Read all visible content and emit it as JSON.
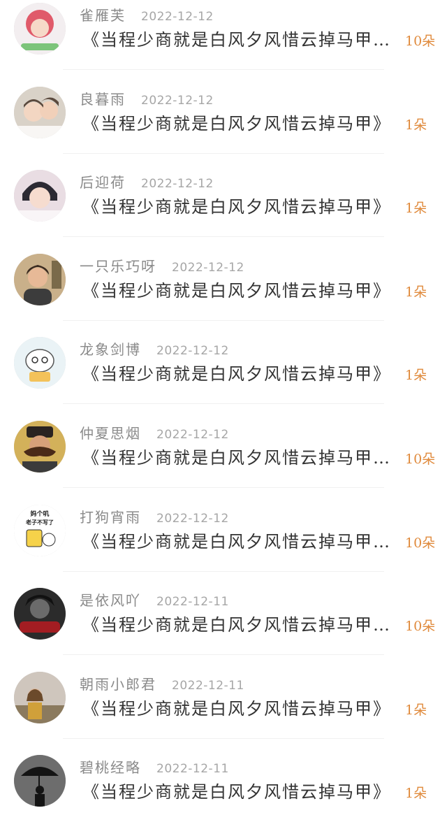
{
  "records": [
    {
      "name": "雀雁芙",
      "date": "2022-12-12",
      "title": "《当程少商就是白风夕风惜云掉马甲…",
      "count": "10朵",
      "avatar": "pink-hair-avatar",
      "avatar_bg": "#f7c6cf",
      "avatar_fg": "#e05a6a"
    },
    {
      "name": "良暮雨",
      "date": "2022-12-12",
      "title": "《当程少商就是白风夕风惜云掉马甲》",
      "count": "1朵",
      "avatar": "kids-avatar",
      "avatar_bg": "#d9d2c8",
      "avatar_fg": "#5b4a3e"
    },
    {
      "name": "后迎荷",
      "date": "2022-12-12",
      "title": "《当程少商就是白风夕风惜云掉马甲》",
      "count": "1朵",
      "avatar": "girl-avatar",
      "avatar_bg": "#e9dde3",
      "avatar_fg": "#2c2a33"
    },
    {
      "name": "一只乐巧呀",
      "date": "2022-12-12",
      "title": "《当程少商就是白风夕风惜云掉马甲》",
      "count": "1朵",
      "avatar": "woman-avatar",
      "avatar_bg": "#c9b08a",
      "avatar_fg": "#3a2a20"
    },
    {
      "name": "龙象剑博",
      "date": "2022-12-12",
      "title": "《当程少商就是白风夕风惜云掉马甲》",
      "count": "1朵",
      "avatar": "cartoon-cat-avatar",
      "avatar_bg": "#eaf3f6",
      "avatar_fg": "#f3c25a"
    },
    {
      "name": "仲夏思烟",
      "date": "2022-12-12",
      "title": "《当程少商就是白风夕风惜云掉马甲…",
      "count": "10朵",
      "avatar": "mustache-man-avatar",
      "avatar_bg": "#d3b15a",
      "avatar_fg": "#2a2320"
    },
    {
      "name": "打狗宵雨",
      "date": "2022-12-12",
      "title": "《当程少商就是白风夕风惜云掉马甲…",
      "count": "10朵",
      "avatar": "meme-sticker-avatar",
      "avatar_bg": "#ffffff",
      "avatar_fg": "#222222",
      "sticker_text": [
        "妈个叽",
        "老子不写了"
      ]
    },
    {
      "name": "是依风吖",
      "date": "2022-12-11",
      "title": "《当程少商就是白风夕风惜云掉马甲…",
      "count": "10朵",
      "avatar": "dark-portrait-avatar",
      "avatar_bg": "#2b2b2b",
      "avatar_fg": "#a31d22"
    },
    {
      "name": "朝雨小郎君",
      "date": "2022-12-11",
      "title": "《当程少商就是白风夕风惜云掉马甲》",
      "count": "1朵",
      "avatar": "outdoor-person-avatar",
      "avatar_bg": "#cfc6bd",
      "avatar_fg": "#6b4a2b"
    },
    {
      "name": "碧桃经略",
      "date": "2022-12-11",
      "title": "《当程少商就是白风夕风惜云掉马甲》",
      "count": "1朵",
      "avatar": "umbrella-silhouette-avatar",
      "avatar_bg": "#6d6d6d",
      "avatar_fg": "#141414"
    }
  ],
  "colors": {
    "accent": "#e08a3c",
    "name": "#8a8a8a",
    "date": "#a6a6a6",
    "title": "#333333",
    "divider": "#f0f0f0"
  }
}
